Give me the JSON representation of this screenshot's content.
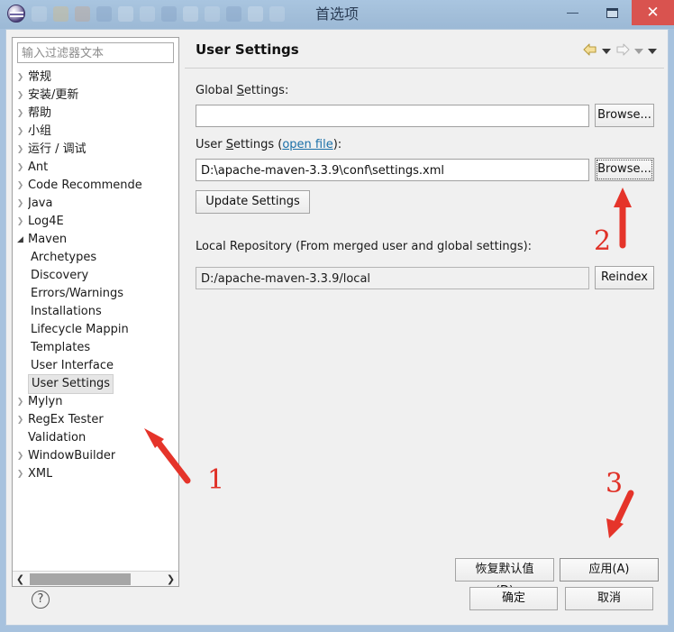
{
  "window": {
    "title": "首选项",
    "logo_icon": "eclipse-logo-icon",
    "minimize_label": "",
    "maximize_label": "",
    "close_label": "✕"
  },
  "sidebar": {
    "filter_placeholder": "输入过滤器文本",
    "filter_value": "",
    "items": [
      {
        "label": "常规",
        "level": 0,
        "expandable": true,
        "expanded": false,
        "selected": false
      },
      {
        "label": "安装/更新",
        "level": 0,
        "expandable": true,
        "expanded": false,
        "selected": false
      },
      {
        "label": "帮助",
        "level": 0,
        "expandable": true,
        "expanded": false,
        "selected": false
      },
      {
        "label": "小组",
        "level": 0,
        "expandable": true,
        "expanded": false,
        "selected": false
      },
      {
        "label": "运行 / 调试",
        "level": 0,
        "expandable": true,
        "expanded": false,
        "selected": false
      },
      {
        "label": "Ant",
        "level": 0,
        "expandable": true,
        "expanded": false,
        "selected": false
      },
      {
        "label": "Code Recommende",
        "level": 0,
        "expandable": true,
        "expanded": false,
        "selected": false
      },
      {
        "label": "Java",
        "level": 0,
        "expandable": true,
        "expanded": false,
        "selected": false
      },
      {
        "label": "Log4E",
        "level": 0,
        "expandable": true,
        "expanded": false,
        "selected": false
      },
      {
        "label": "Maven",
        "level": 0,
        "expandable": true,
        "expanded": true,
        "selected": false
      },
      {
        "label": "Archetypes",
        "level": 1,
        "expandable": false,
        "expanded": false,
        "selected": false
      },
      {
        "label": "Discovery",
        "level": 1,
        "expandable": false,
        "expanded": false,
        "selected": false
      },
      {
        "label": "Errors/Warnings",
        "level": 1,
        "expandable": false,
        "expanded": false,
        "selected": false
      },
      {
        "label": "Installations",
        "level": 1,
        "expandable": false,
        "expanded": false,
        "selected": false
      },
      {
        "label": "Lifecycle Mappin",
        "level": 1,
        "expandable": false,
        "expanded": false,
        "selected": false
      },
      {
        "label": "Templates",
        "level": 1,
        "expandable": false,
        "expanded": false,
        "selected": false
      },
      {
        "label": "User Interface",
        "level": 1,
        "expandable": false,
        "expanded": false,
        "selected": false
      },
      {
        "label": "User Settings",
        "level": 1,
        "expandable": false,
        "expanded": false,
        "selected": true
      },
      {
        "label": "Mylyn",
        "level": 0,
        "expandable": true,
        "expanded": false,
        "selected": false
      },
      {
        "label": "RegEx Tester",
        "level": 0,
        "expandable": true,
        "expanded": false,
        "selected": false
      },
      {
        "label": "Validation",
        "level": 0,
        "expandable": false,
        "expanded": false,
        "selected": false
      },
      {
        "label": "WindowBuilder",
        "level": 0,
        "expandable": true,
        "expanded": false,
        "selected": false
      },
      {
        "label": "XML",
        "level": 0,
        "expandable": true,
        "expanded": false,
        "selected": false
      }
    ],
    "scroll_left_glyph": "❮",
    "scroll_right_glyph": "❯"
  },
  "main": {
    "title": "User Settings",
    "nav": {
      "back_icon": "back-arrow-icon",
      "back_dropdown_icon": "chevron-down-icon",
      "forward_icon": "forward-arrow-icon",
      "forward_dropdown_icon": "chevron-down-icon",
      "menu_icon": "chevron-down-icon"
    },
    "global_settings": {
      "label_pre": "Global ",
      "label_mnemonic": "S",
      "label_post": "ettings:",
      "value": "",
      "browse_label": "Browse..."
    },
    "user_settings": {
      "label_pre": "User ",
      "label_mnemonic": "S",
      "label_mid": "ettings (",
      "link_label": "open file",
      "label_post": "):",
      "value": "D:\\apache-maven-3.3.9\\conf\\settings.xml",
      "browse_label": "Browse...",
      "update_label": "Update Settings"
    },
    "local_repository": {
      "label": "Local Repository (From merged user and global settings):",
      "value": "D:/apache-maven-3.3.9/local",
      "reindex_label": "Reindex"
    },
    "restore_defaults_label": "恢复默认值(D)",
    "apply_label": "应用(A)"
  },
  "footer": {
    "help_icon": "question-mark-icon",
    "ok_label": "确定",
    "cancel_label": "取消"
  },
  "annotations": {
    "one": "1",
    "two": "2",
    "three": "3",
    "color": "#e03127"
  }
}
